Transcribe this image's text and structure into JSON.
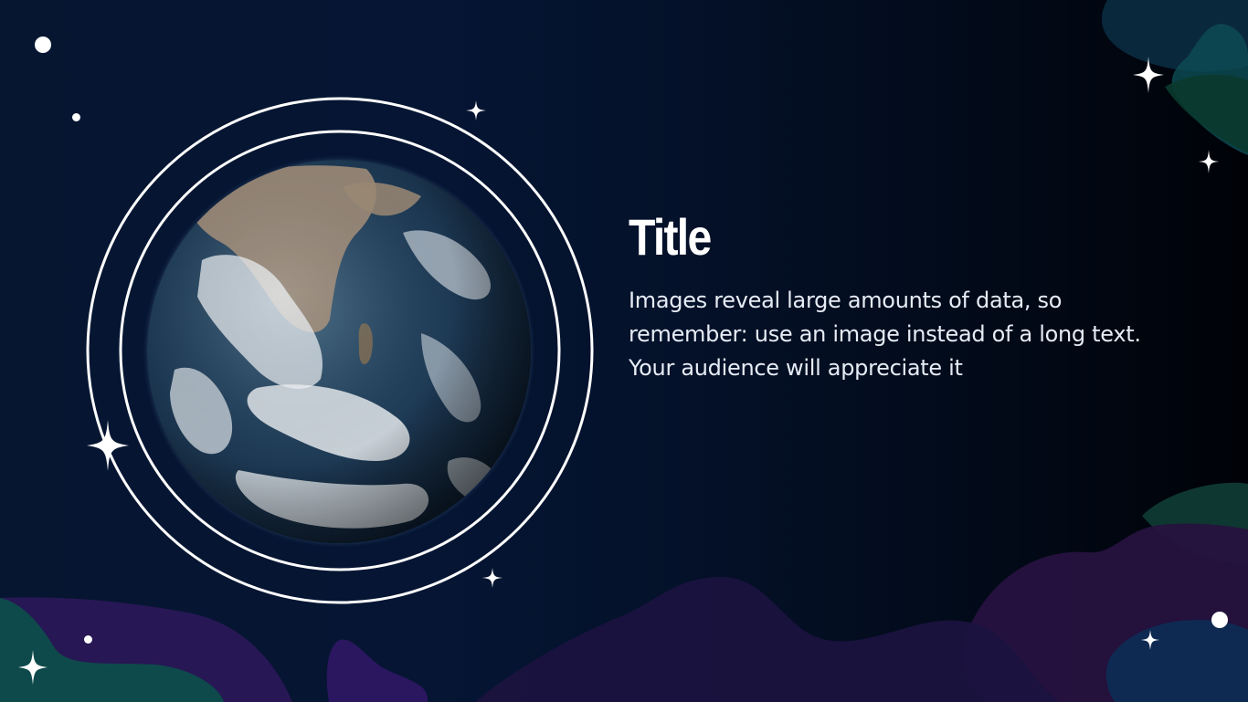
{
  "slide": {
    "title": "Title",
    "body": "Images reveal large amounts of data, so remember: use an image instead of a long text. Your audience will appreciate it"
  },
  "colors": {
    "background_left": "#061631",
    "background_right": "#000207",
    "orbit_ring": "#ffffff",
    "title_text": "#ffffff",
    "body_text": "#e6ecf5",
    "blob_teal": "#0f3a44",
    "blob_purple": "#2a1550",
    "blob_navy": "#0b2545"
  },
  "decor": {
    "earth_image": "earth-globe-photo",
    "star_icon": "four-point-sparkle",
    "dot_icon": "white-dot"
  }
}
